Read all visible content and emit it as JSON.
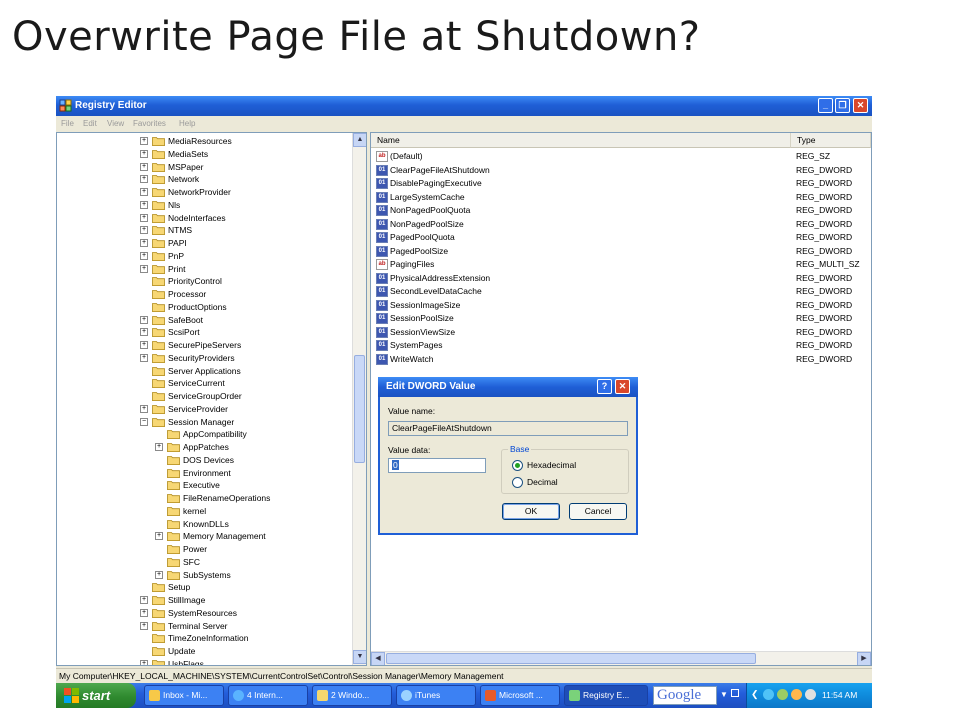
{
  "slide": {
    "title": "Overwrite Page File at Shutdown?"
  },
  "window": {
    "title": "Registry Editor",
    "menu": [
      "File",
      "Edit",
      "View",
      "Favorites",
      "Help"
    ]
  },
  "tree": {
    "items": [
      {
        "label": "MediaResources",
        "expander": "+"
      },
      {
        "label": "MediaSets",
        "expander": "+"
      },
      {
        "label": "MSPaper",
        "expander": "+"
      },
      {
        "label": "Network",
        "expander": "+"
      },
      {
        "label": "NetworkProvider",
        "expander": "+"
      },
      {
        "label": "Nls",
        "expander": "+"
      },
      {
        "label": "NodeInterfaces",
        "expander": "+"
      },
      {
        "label": "NTMS",
        "expander": "+"
      },
      {
        "label": "PAPI",
        "expander": "+"
      },
      {
        "label": "PnP",
        "expander": "+"
      },
      {
        "label": "Print",
        "expander": "+"
      },
      {
        "label": "PriorityControl",
        "expander": ""
      },
      {
        "label": "Processor",
        "expander": ""
      },
      {
        "label": "ProductOptions",
        "expander": ""
      },
      {
        "label": "SafeBoot",
        "expander": "+"
      },
      {
        "label": "ScsiPort",
        "expander": "+"
      },
      {
        "label": "SecurePipeServers",
        "expander": "+"
      },
      {
        "label": "SecurityProviders",
        "expander": "+"
      },
      {
        "label": "Server Applications",
        "expander": ""
      },
      {
        "label": "ServiceCurrent",
        "expander": ""
      },
      {
        "label": "ServiceGroupOrder",
        "expander": ""
      },
      {
        "label": "ServiceProvider",
        "expander": "+"
      },
      {
        "label": "Session Manager",
        "expander": "-"
      },
      {
        "label": "AppCompatibility",
        "expander": "",
        "child": true
      },
      {
        "label": "AppPatches",
        "expander": "+",
        "child": true
      },
      {
        "label": "DOS Devices",
        "expander": "",
        "child": true
      },
      {
        "label": "Environment",
        "expander": "",
        "child": true
      },
      {
        "label": "Executive",
        "expander": "",
        "child": true
      },
      {
        "label": "FileRenameOperations",
        "expander": "",
        "child": true
      },
      {
        "label": "kernel",
        "expander": "",
        "child": true
      },
      {
        "label": "KnownDLLs",
        "expander": "",
        "child": true
      },
      {
        "label": "Memory Management",
        "expander": "+",
        "child": true,
        "open": true
      },
      {
        "label": "Power",
        "expander": "",
        "child": true
      },
      {
        "label": "SFC",
        "expander": "",
        "child": true
      },
      {
        "label": "SubSystems",
        "expander": "+",
        "child": true
      },
      {
        "label": "Setup",
        "expander": ""
      },
      {
        "label": "StillImage",
        "expander": "+"
      },
      {
        "label": "SystemResources",
        "expander": "+"
      },
      {
        "label": "Terminal Server",
        "expander": "+"
      },
      {
        "label": "TimeZoneInformation",
        "expander": ""
      },
      {
        "label": "Update",
        "expander": ""
      },
      {
        "label": "UsbFlags",
        "expander": "+"
      }
    ]
  },
  "list": {
    "columns": [
      "Name",
      "Type"
    ],
    "rows": [
      {
        "name": "(Default)",
        "type": "REG_SZ",
        "icon": "ab"
      },
      {
        "name": "ClearPageFileAtShutdown",
        "type": "REG_DWORD",
        "icon": "bin"
      },
      {
        "name": "DisablePagingExecutive",
        "type": "REG_DWORD",
        "icon": "bin"
      },
      {
        "name": "LargeSystemCache",
        "type": "REG_DWORD",
        "icon": "bin"
      },
      {
        "name": "NonPagedPoolQuota",
        "type": "REG_DWORD",
        "icon": "bin"
      },
      {
        "name": "NonPagedPoolSize",
        "type": "REG_DWORD",
        "icon": "bin"
      },
      {
        "name": "PagedPoolQuota",
        "type": "REG_DWORD",
        "icon": "bin"
      },
      {
        "name": "PagedPoolSize",
        "type": "REG_DWORD",
        "icon": "bin"
      },
      {
        "name": "PagingFiles",
        "type": "REG_MULTI_SZ",
        "icon": "ab"
      },
      {
        "name": "PhysicalAddressExtension",
        "type": "REG_DWORD",
        "icon": "bin"
      },
      {
        "name": "SecondLevelDataCache",
        "type": "REG_DWORD",
        "icon": "bin"
      },
      {
        "name": "SessionImageSize",
        "type": "REG_DWORD",
        "icon": "bin"
      },
      {
        "name": "SessionPoolSize",
        "type": "REG_DWORD",
        "icon": "bin"
      },
      {
        "name": "SessionViewSize",
        "type": "REG_DWORD",
        "icon": "bin"
      },
      {
        "name": "SystemPages",
        "type": "REG_DWORD",
        "icon": "bin"
      },
      {
        "name": "WriteWatch",
        "type": "REG_DWORD",
        "icon": "bin"
      }
    ]
  },
  "statusbar": {
    "path": "My Computer\\HKEY_LOCAL_MACHINE\\SYSTEM\\CurrentControlSet\\Control\\Session Manager\\Memory Management"
  },
  "dialog": {
    "title": "Edit DWORD Value",
    "value_name_label": "Value name:",
    "value_name": "ClearPageFileAtShutdown",
    "value_data_label": "Value data:",
    "value_data": "0",
    "base_label": "Base",
    "hex_label": "Hexadecimal",
    "dec_label": "Decimal",
    "selected_base": "Hexadecimal",
    "ok_label": "OK",
    "cancel_label": "Cancel",
    "help_label": "?"
  },
  "taskbar": {
    "start_label": "start",
    "buttons": [
      {
        "label": "Inbox - Mi..."
      },
      {
        "label": "4 Intern..."
      },
      {
        "label": "2 Windo..."
      },
      {
        "label": "iTunes"
      },
      {
        "label": "Microsoft ..."
      },
      {
        "label": "Registry E..."
      }
    ],
    "search_text": "Google",
    "clock": "11:54 AM"
  },
  "colors": {
    "xp_blue": "#245edb",
    "start_green": "#2f8a2f",
    "dialog_face": "#ECE9D8"
  }
}
